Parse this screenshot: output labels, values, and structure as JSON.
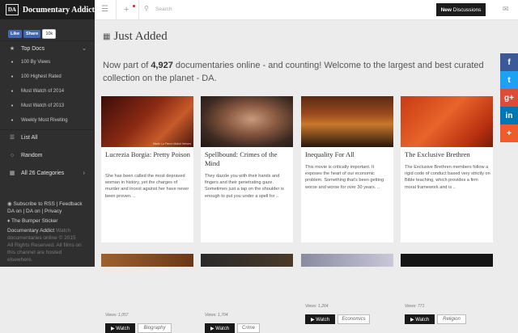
{
  "site": {
    "logo_mark": "DA",
    "name": "Documentary Addict"
  },
  "facebook": {
    "like": "Like",
    "share": "Share",
    "count": "10k"
  },
  "sidebar": {
    "top_docs": "Top Docs",
    "sub_items": [
      {
        "label": "100 By Views"
      },
      {
        "label": "100 Highest Rated"
      },
      {
        "label": "Must Watch of 2014"
      },
      {
        "label": "Must Watch of 2013"
      },
      {
        "label": "Weekly Most Riveting"
      }
    ],
    "list_all": "List All",
    "random": "Random",
    "all_categories": "All 26 Categories",
    "footer": {
      "line1": "Subscribe to RSS | Feedback",
      "line2": "DA on  | DA on  | Privacy",
      "bumper": "The Bumper Sticker",
      "brand": "Documentary Addict",
      "brand_tag": "Watch",
      "line5": "documentaries online © 2015",
      "line6": "All Rights Reserved. All films on",
      "line7": "this channel are hosted",
      "line8": "elsewhere."
    }
  },
  "topbar": {
    "search_placeholder": "Search",
    "new_discussions": "New Discussions",
    "new_discussions_bold": "New"
  },
  "main": {
    "title": "Just Added",
    "intro_pre": "Now part of ",
    "intro_count": "4,927",
    "intro_post": " documentaries online - and counting! Welcome to the largest and best curated collection on the planet - DA.",
    "watch_label": "▶ Watch",
    "cards": [
      {
        "title": "Lucrezia Borgia: Pretty Poison",
        "desc": "She has been called the most depraved woman in history, yet the charges of murder and incest against her have never been proven. ..",
        "views": "Views: 1,057",
        "tag": "Biography",
        "watermark": "Marie La Fievre Mabel Heinen"
      },
      {
        "title": "Spellbound: Crimes of the Mind",
        "desc": "They dazzle you with their hands and fingers and their penetrating gaze. Sometimes just a tap on the shoulder is enough to put you under a spell for ..",
        "views": "Views: 1,704",
        "tag": "Crime"
      },
      {
        "title": "Inequality For All",
        "desc": "This movie is critically important. It exposes the heart of our economic problem. Something that's been getting worse and worse for over 30 years. ..",
        "views": "Views: 1,264",
        "tag": "Economics"
      },
      {
        "title": "The Exclusive Brethren",
        "desc": "The Exclusive Brethren members follow a rigid code of conduct based very strictly on Bible teaching, which provides a firm moral framework and is ..",
        "views": "Views: 771",
        "tag": "Religion"
      }
    ]
  },
  "share_buttons": [
    {
      "name": "facebook",
      "glyph": "f",
      "color": "#3b5998"
    },
    {
      "name": "twitter",
      "glyph": "t",
      "color": "#1da1f2"
    },
    {
      "name": "google-plus",
      "glyph": "g+",
      "color": "#dd4b39"
    },
    {
      "name": "linkedin",
      "glyph": "in",
      "color": "#0077b5"
    },
    {
      "name": "more",
      "glyph": "+",
      "color": "#f15a2b"
    }
  ],
  "colors": {
    "sidebar_bg": "#2f2f2f",
    "accent_dark": "#1a1a1a"
  }
}
